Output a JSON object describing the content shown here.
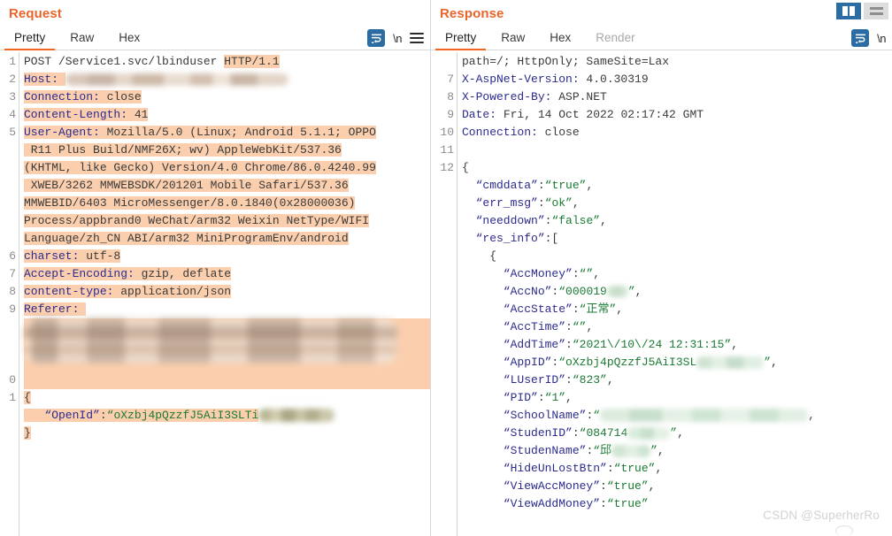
{
  "layout_toggles": [
    {
      "name": "split-vertical",
      "active": true
    },
    {
      "name": "split-horizontal",
      "active": false
    }
  ],
  "request": {
    "title": "Request",
    "tabs": [
      {
        "label": "Pretty",
        "active": true,
        "disabled": false
      },
      {
        "label": "Raw",
        "active": false,
        "disabled": false
      },
      {
        "label": "Hex",
        "active": false,
        "disabled": false
      }
    ],
    "actions": {
      "wrap_icon": "word-wrap-icon",
      "newline_label": "\\n",
      "menu_icon": "hamburger-menu-icon"
    },
    "gutter": [
      "1",
      "2",
      "3",
      "4",
      "5",
      "",
      "",
      "",
      "",
      "",
      "",
      "6",
      "7",
      "8",
      "9",
      "",
      "",
      "",
      "0",
      "1",
      "",
      ""
    ],
    "lines": [
      {
        "segments": [
          {
            "t": "POST /Service1.svc/lbinduser ",
            "c": "v",
            "hl": false
          },
          {
            "t": "HTTP/1.1",
            "c": "v",
            "hl": true
          }
        ]
      },
      {
        "segments": [
          {
            "t": "Host:",
            "c": "k",
            "hl": true
          },
          {
            "t": " ",
            "c": "v",
            "hl": true
          }
        ],
        "blur": "host"
      },
      {
        "segments": [
          {
            "t": "Connection:",
            "c": "k",
            "hl": true
          },
          {
            "t": " close",
            "c": "v",
            "hl": true
          }
        ]
      },
      {
        "segments": [
          {
            "t": "Content-Length:",
            "c": "k",
            "hl": true
          },
          {
            "t": " 41",
            "c": "v",
            "hl": true
          }
        ]
      },
      {
        "segments": [
          {
            "t": "User-Agent:",
            "c": "k",
            "hl": true
          },
          {
            "t": " Mozilla/5.0 (Linux; Android 5.1.1; OPPO",
            "c": "v",
            "hl": true
          }
        ]
      },
      {
        "segments": [
          {
            "t": " R11 Plus Build/NMF26X; wv) AppleWebKit/537.36",
            "c": "v",
            "hl": true
          }
        ]
      },
      {
        "segments": [
          {
            "t": "(KHTML, like Gecko) Version/4.0 Chrome/86.0.4240.99",
            "c": "v",
            "hl": true
          }
        ]
      },
      {
        "segments": [
          {
            "t": " XWEB/3262 MMWEBSDK/201201 Mobile Safari/537.36",
            "c": "v",
            "hl": true
          }
        ]
      },
      {
        "segments": [
          {
            "t": "MMWEBID/6403 MicroMessenger/8.0.1840(0x28000036)",
            "c": "v",
            "hl": true
          }
        ]
      },
      {
        "segments": [
          {
            "t": "Process/appbrand0 WeChat/arm32 Weixin NetType/WIFI",
            "c": "v",
            "hl": true
          }
        ]
      },
      {
        "segments": [
          {
            "t": "Language/zh_CN ABI/arm32 MiniProgramEnv/android",
            "c": "v",
            "hl": true
          }
        ]
      },
      {
        "segments": [
          {
            "t": "charset:",
            "c": "k",
            "hl": true
          },
          {
            "t": " utf-8",
            "c": "v",
            "hl": true
          }
        ]
      },
      {
        "segments": [
          {
            "t": "Accept-Encoding:",
            "c": "k",
            "hl": true
          },
          {
            "t": " gzip, deflate",
            "c": "v",
            "hl": true
          }
        ]
      },
      {
        "segments": [
          {
            "t": "content-type:",
            "c": "k",
            "hl": true
          },
          {
            "t": " application/json",
            "c": "v",
            "hl": true
          }
        ]
      },
      {
        "segments": [
          {
            "t": "Referer:",
            "c": "k",
            "hl": true
          },
          {
            "t": " ",
            "c": "v",
            "hl": true
          }
        ]
      },
      {
        "segments": [],
        "blur": "referer"
      },
      {
        "segments": []
      },
      {
        "segments": []
      },
      {
        "segments": []
      },
      {
        "segments": [
          {
            "t": "{",
            "c": "p",
            "hl": true
          }
        ]
      },
      {
        "segments": [
          {
            "t": "   “OpenId”",
            "c": "k",
            "hl": true
          },
          {
            "t": ":",
            "c": "p",
            "hl": true
          },
          {
            "t": "“oXzbj4pQzzfJ5AiI3SLTi",
            "c": "s",
            "hl": true
          }
        ],
        "blur": "openid"
      },
      {
        "segments": [
          {
            "t": "}",
            "c": "p",
            "hl": true
          }
        ]
      }
    ]
  },
  "response": {
    "title": "Response",
    "tabs": [
      {
        "label": "Pretty",
        "active": true,
        "disabled": false
      },
      {
        "label": "Raw",
        "active": false,
        "disabled": false
      },
      {
        "label": "Hex",
        "active": false,
        "disabled": false
      },
      {
        "label": "Render",
        "active": false,
        "disabled": true
      }
    ],
    "actions": {
      "wrap_icon": "word-wrap-icon",
      "newline_label": "\\n"
    },
    "gutter": [
      "",
      "7",
      "8",
      "9",
      "10",
      "11",
      "12",
      "",
      "",
      "",
      "",
      "",
      "",
      "",
      "",
      "",
      "",
      "",
      "",
      "",
      "",
      "",
      "",
      "",
      "",
      ""
    ],
    "lines": [
      {
        "segments": [
          {
            "t": "path=/; HttpOnly; SameSite=Lax",
            "c": "v"
          }
        ]
      },
      {
        "segments": [
          {
            "t": "X-AspNet-Version:",
            "c": "k"
          },
          {
            "t": " 4.0.30319",
            "c": "v"
          }
        ]
      },
      {
        "segments": [
          {
            "t": "X-Powered-By:",
            "c": "k"
          },
          {
            "t": " ASP.NET",
            "c": "v"
          }
        ]
      },
      {
        "segments": [
          {
            "t": "Date:",
            "c": "k"
          },
          {
            "t": " Fri, 14 Oct 2022 02:17:42 GMT",
            "c": "v"
          }
        ]
      },
      {
        "segments": [
          {
            "t": "Connection:",
            "c": "k"
          },
          {
            "t": " close",
            "c": "v"
          }
        ]
      },
      {
        "segments": []
      },
      {
        "segments": [
          {
            "t": "{",
            "c": "p"
          }
        ]
      },
      {
        "segments": [
          {
            "t": "  “cmddata”",
            "c": "k"
          },
          {
            "t": ":",
            "c": "p"
          },
          {
            "t": "“true”",
            "c": "s"
          },
          {
            "t": ",",
            "c": "p"
          }
        ]
      },
      {
        "segments": [
          {
            "t": "  “err_msg”",
            "c": "k"
          },
          {
            "t": ":",
            "c": "p"
          },
          {
            "t": "“ok”",
            "c": "s"
          },
          {
            "t": ",",
            "c": "p"
          }
        ]
      },
      {
        "segments": [
          {
            "t": "  “needdown”",
            "c": "k"
          },
          {
            "t": ":",
            "c": "p"
          },
          {
            "t": "“false”",
            "c": "s"
          },
          {
            "t": ",",
            "c": "p"
          }
        ]
      },
      {
        "segments": [
          {
            "t": "  “res_info”",
            "c": "k"
          },
          {
            "t": ":[",
            "c": "p"
          }
        ]
      },
      {
        "segments": [
          {
            "t": "    {",
            "c": "p"
          }
        ]
      },
      {
        "segments": [
          {
            "t": "      “AccMoney”",
            "c": "k"
          },
          {
            "t": ":",
            "c": "p"
          },
          {
            "t": "“”",
            "c": "s"
          },
          {
            "t": ",",
            "c": "p"
          }
        ]
      },
      {
        "segments": [
          {
            "t": "      “AccNo”",
            "c": "k"
          },
          {
            "t": ":",
            "c": "p"
          },
          {
            "t": "“000019",
            "c": "s"
          }
        ],
        "blur": "accno",
        "after": [
          {
            "t": "”",
            "c": "s"
          },
          {
            "t": ",",
            "c": "p"
          }
        ]
      },
      {
        "segments": [
          {
            "t": "      “AccState”",
            "c": "k"
          },
          {
            "t": ":",
            "c": "p"
          },
          {
            "t": "“正常”",
            "c": "s"
          },
          {
            "t": ",",
            "c": "p"
          }
        ]
      },
      {
        "segments": [
          {
            "t": "      “AccTime”",
            "c": "k"
          },
          {
            "t": ":",
            "c": "p"
          },
          {
            "t": "“”",
            "c": "s"
          },
          {
            "t": ",",
            "c": "p"
          }
        ]
      },
      {
        "segments": [
          {
            "t": "      “AddTime”",
            "c": "k"
          },
          {
            "t": ":",
            "c": "p"
          },
          {
            "t": "“2021\\/10\\/24 12:31:15”",
            "c": "s"
          },
          {
            "t": ",",
            "c": "p"
          }
        ]
      },
      {
        "segments": [
          {
            "t": "      “AppID”",
            "c": "k"
          },
          {
            "t": ":",
            "c": "p"
          },
          {
            "t": "“oXzbj4pQzzfJ5AiI3SL",
            "c": "s"
          }
        ],
        "blur": "appid",
        "after": [
          {
            "t": "”",
            "c": "s"
          },
          {
            "t": ",",
            "c": "p"
          }
        ]
      },
      {
        "segments": [
          {
            "t": "      “LUserID”",
            "c": "k"
          },
          {
            "t": ":",
            "c": "p"
          },
          {
            "t": "“823”",
            "c": "s"
          },
          {
            "t": ",",
            "c": "p"
          }
        ]
      },
      {
        "segments": [
          {
            "t": "      “PID”",
            "c": "k"
          },
          {
            "t": ":",
            "c": "p"
          },
          {
            "t": "“1”",
            "c": "s"
          },
          {
            "t": ",",
            "c": "p"
          }
        ]
      },
      {
        "segments": [
          {
            "t": "      “SchoolName”",
            "c": "k"
          },
          {
            "t": ":",
            "c": "p"
          },
          {
            "t": "“",
            "c": "s"
          }
        ],
        "blur": "school",
        "after": [
          {
            "t": ",",
            "c": "p"
          }
        ]
      },
      {
        "segments": [
          {
            "t": "      “StudenID”",
            "c": "k"
          },
          {
            "t": ":",
            "c": "p"
          },
          {
            "t": "“084714",
            "c": "s"
          }
        ],
        "blur": "student",
        "after": [
          {
            "t": "”",
            "c": "s"
          },
          {
            "t": ",",
            "c": "p"
          }
        ]
      },
      {
        "segments": [
          {
            "t": "      “StudenName”",
            "c": "k"
          },
          {
            "t": ":",
            "c": "p"
          },
          {
            "t": "“邱",
            "c": "s"
          }
        ],
        "blur": "name",
        "after": [
          {
            "t": "”",
            "c": "s"
          },
          {
            "t": ",",
            "c": "p"
          }
        ]
      },
      {
        "segments": [
          {
            "t": "      “HideUnLostBtn”",
            "c": "k"
          },
          {
            "t": ":",
            "c": "p"
          },
          {
            "t": "“true”",
            "c": "s"
          },
          {
            "t": ",",
            "c": "p"
          }
        ]
      },
      {
        "segments": [
          {
            "t": "      “ViewAccMoney”",
            "c": "k"
          },
          {
            "t": ":",
            "c": "p"
          },
          {
            "t": "“true”",
            "c": "s"
          },
          {
            "t": ",",
            "c": "p"
          }
        ]
      },
      {
        "segments": [
          {
            "t": "      “ViewAddMoney”",
            "c": "k"
          },
          {
            "t": ":",
            "c": "p"
          },
          {
            "t": "“true”",
            "c": "s"
          }
        ]
      }
    ]
  },
  "watermark": "CSDN @SuperherRo",
  "colors": {
    "accent": "#f26522",
    "title": "#e8652b",
    "highlight": "#fbcfae",
    "key": "#2b2b8f",
    "string": "#1a7a33",
    "active_toggle": "#2b6ca3"
  }
}
